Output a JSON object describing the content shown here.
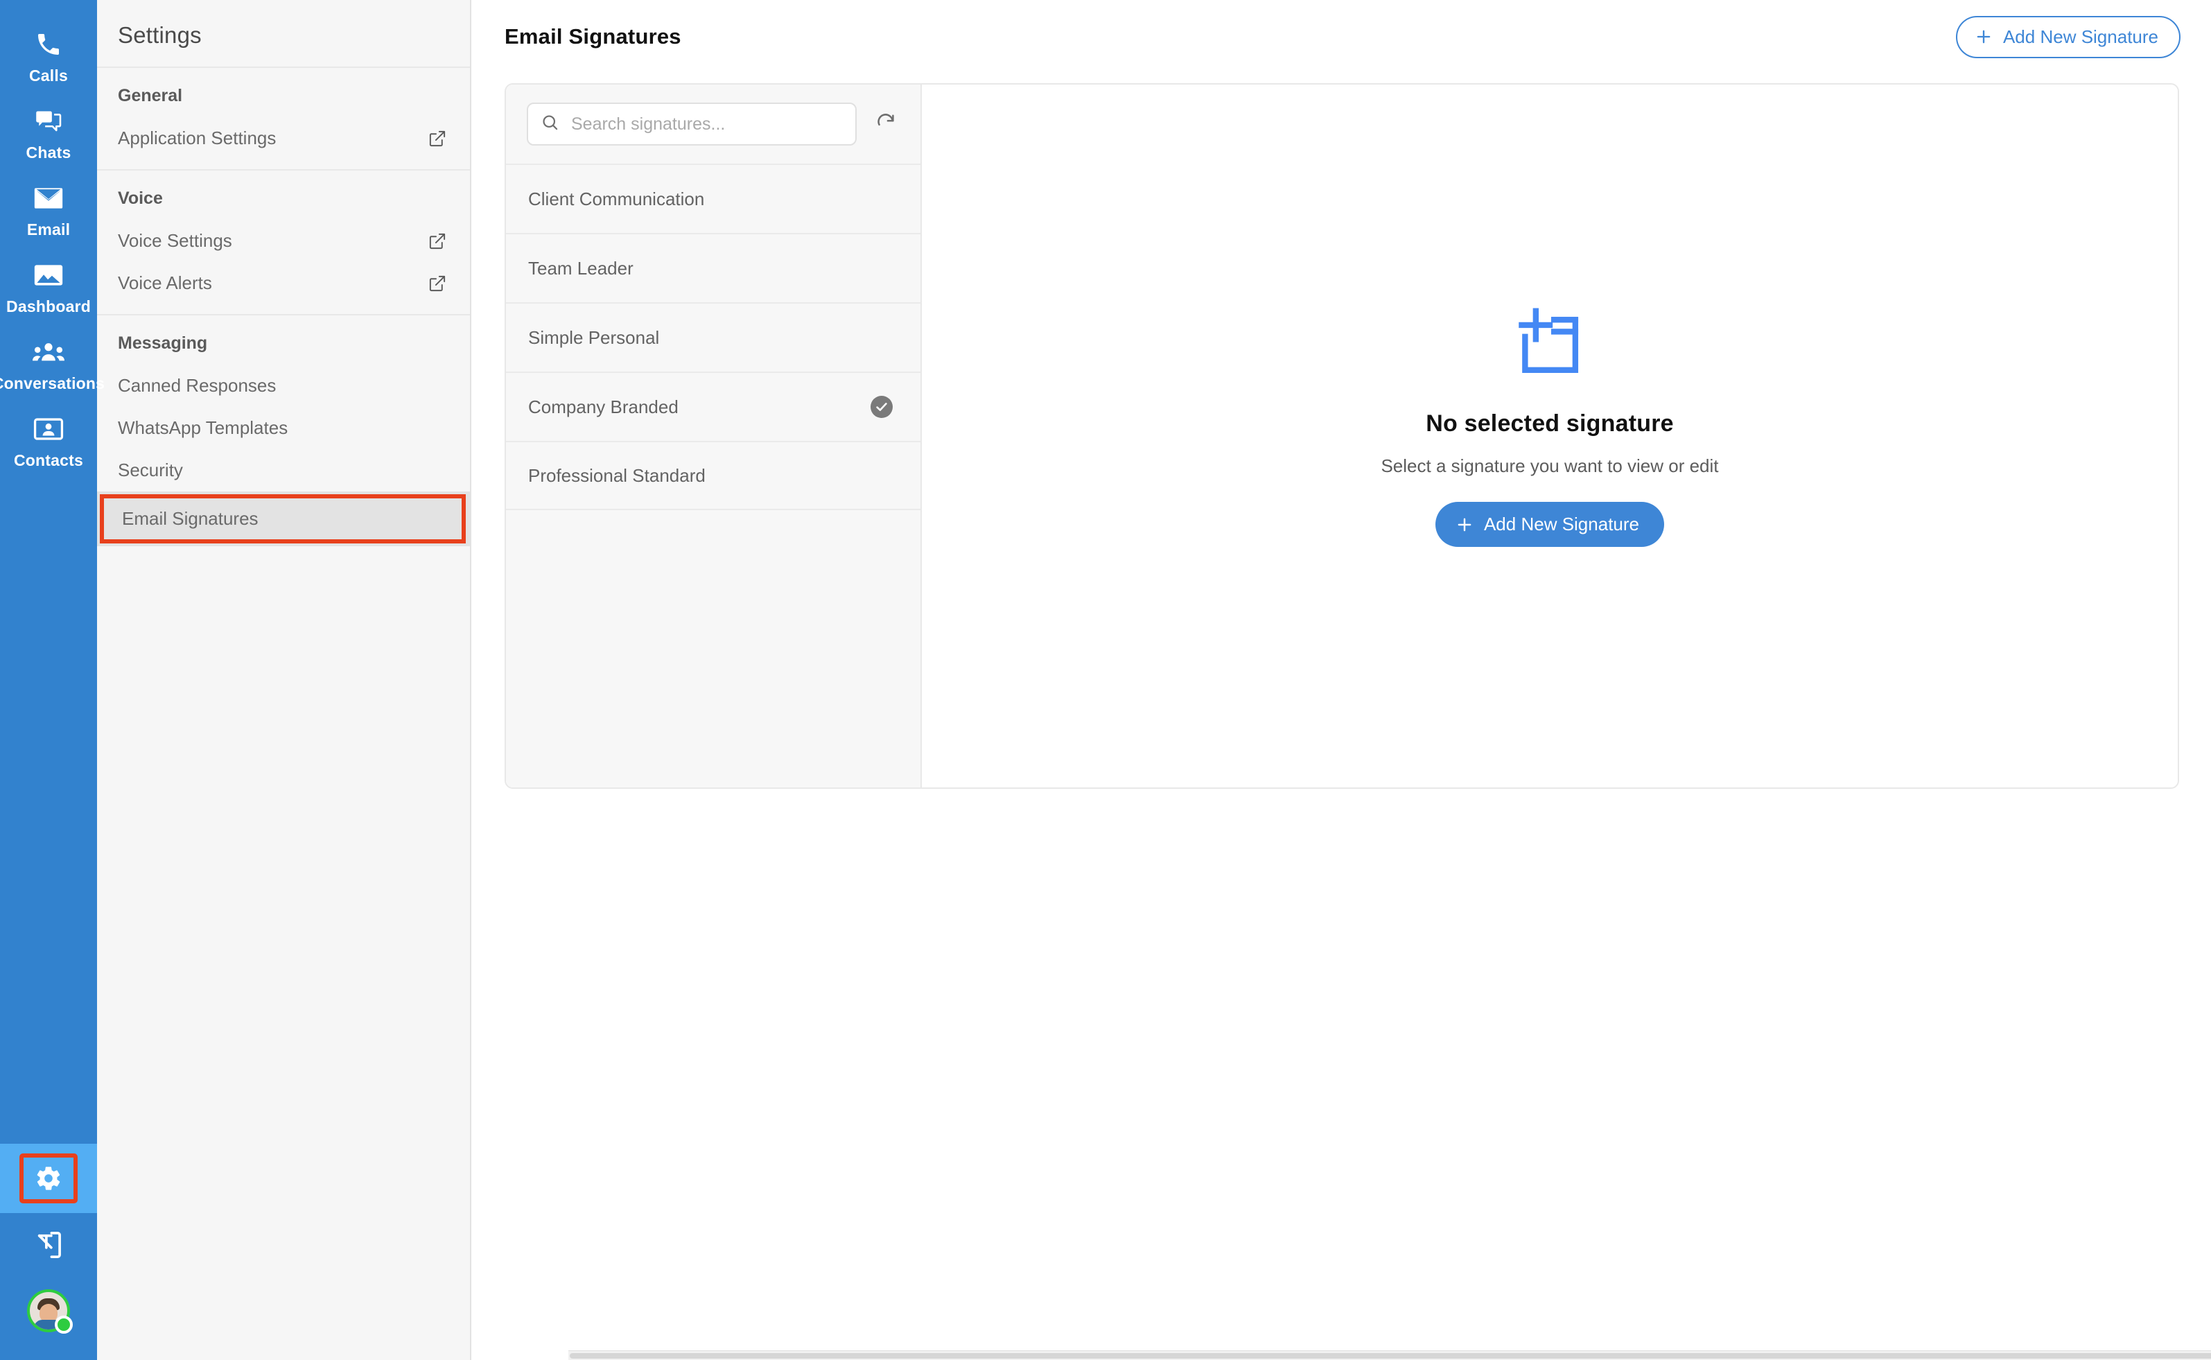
{
  "rail": {
    "items": [
      {
        "label": "Calls",
        "icon": "phone-icon"
      },
      {
        "label": "Chats",
        "icon": "chat-bubbles-icon"
      },
      {
        "label": "Email",
        "icon": "envelope-icon"
      },
      {
        "label": "Dashboard",
        "icon": "dashboard-image-icon"
      },
      {
        "label": "Conversations",
        "icon": "people-group-icon"
      },
      {
        "label": "Contacts",
        "icon": "contact-card-icon"
      }
    ],
    "bottom": {
      "settings_icon": "gear-icon",
      "logout_icon": "logout-arrow-icon",
      "avatar_icon": "user-avatar",
      "status": "online"
    },
    "accent_color": "#3282CE",
    "active_color": "#53AEF3",
    "highlight_color": "#E8401C"
  },
  "settings": {
    "title": "Settings",
    "groups": [
      {
        "label": "General",
        "rows": [
          {
            "label": "Application Settings",
            "icon": "external-link-icon",
            "selected": false
          }
        ]
      },
      {
        "label": "Voice",
        "rows": [
          {
            "label": "Voice Settings",
            "icon": "external-link-icon",
            "selected": false
          },
          {
            "label": "Voice Alerts",
            "icon": "external-link-icon",
            "selected": false
          }
        ]
      },
      {
        "label": "Messaging",
        "rows": [
          {
            "label": "Canned Responses",
            "icon": "",
            "selected": false
          },
          {
            "label": "WhatsApp Templates",
            "icon": "",
            "selected": false
          },
          {
            "label": "Security",
            "icon": "",
            "selected": false
          },
          {
            "label": "Email Signatures",
            "icon": "",
            "selected": true
          }
        ]
      }
    ]
  },
  "header": {
    "title": "Email Signatures",
    "add_button_label": "Add New Signature",
    "add_button_icon": "plus-icon"
  },
  "list": {
    "search": {
      "placeholder": "Search signatures...",
      "value": "",
      "icon": "search-icon"
    },
    "refresh_icon": "refresh-icon",
    "items": [
      {
        "name": "Client Communication",
        "is_default": false
      },
      {
        "name": "Team Leader",
        "is_default": false
      },
      {
        "name": "Simple Personal",
        "is_default": false
      },
      {
        "name": "Company Branded",
        "is_default": true
      },
      {
        "name": "Professional Standard",
        "is_default": false
      }
    ],
    "default_badge_icon": "check-circle-icon"
  },
  "preview": {
    "empty_icon": "add-note-box-icon",
    "empty_title": "No selected signature",
    "empty_subtitle": "Select a signature you want to view or edit",
    "empty_button_label": "Add New Signature",
    "empty_button_icon": "plus-icon",
    "accent_color": "#4488F4"
  }
}
